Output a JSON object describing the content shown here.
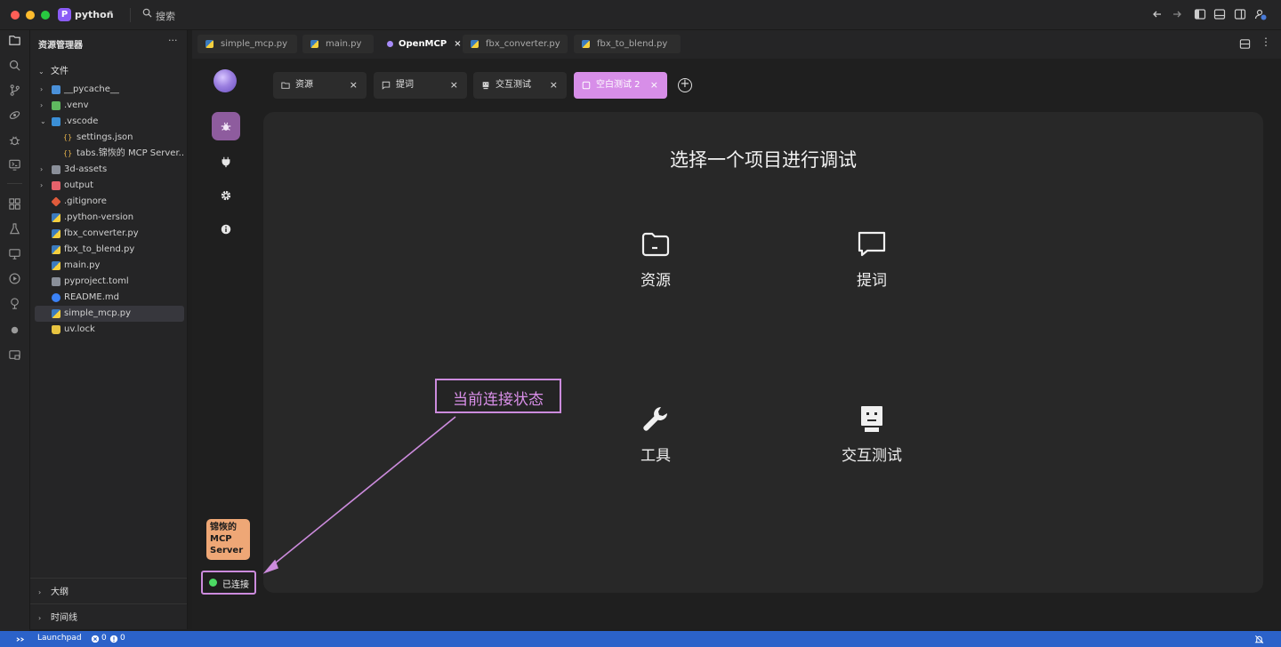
{
  "titlebar": {
    "project_badge": "P",
    "project_name": "python",
    "search_label": "搜索"
  },
  "explorer": {
    "title": "资源管理器",
    "more": "···",
    "files_section": "文件",
    "items": [
      {
        "label": "__pycache__",
        "icon": "folder-icon"
      },
      {
        "label": ".venv",
        "icon": "folder-icon"
      },
      {
        "label": ".vscode",
        "icon": "folder-open-icon"
      },
      {
        "label": "settings.json",
        "icon": "json-icon"
      },
      {
        "label": "tabs.锦恢的 MCP Server...",
        "icon": "json-icon"
      },
      {
        "label": "3d-assets",
        "icon": "folder-icon"
      },
      {
        "label": "output",
        "icon": "folder-icon"
      },
      {
        "label": ".gitignore",
        "icon": "git-icon"
      },
      {
        "label": ".python-version",
        "icon": "python-file-icon"
      },
      {
        "label": "fbx_converter.py",
        "icon": "python-file-icon"
      },
      {
        "label": "fbx_to_blend.py",
        "icon": "python-file-icon"
      },
      {
        "label": "main.py",
        "icon": "python-file-icon"
      },
      {
        "label": "pyproject.toml",
        "icon": "toml-icon"
      },
      {
        "label": "README.md",
        "icon": "info-file-icon"
      },
      {
        "label": "simple_mcp.py",
        "icon": "python-file-icon"
      },
      {
        "label": "uv.lock",
        "icon": "lock-icon"
      }
    ],
    "outline_section": "大纲",
    "timeline_section": "时间线"
  },
  "editor_tabs": [
    {
      "label": "simple_mcp.py"
    },
    {
      "label": "main.py"
    },
    {
      "label": "OpenMCP",
      "close": "×"
    },
    {
      "label": "fbx_converter.py"
    },
    {
      "label": "fbx_to_blend.py"
    }
  ],
  "app": {
    "server_name": "锦恢的 MCP Server",
    "connection_status": "已连接",
    "panel_tabs": [
      {
        "label": "资源",
        "close": "×"
      },
      {
        "label": "提词",
        "close": "×"
      },
      {
        "label": "交互测试",
        "close": "×"
      },
      {
        "label": "空白测试 2",
        "close": "×"
      }
    ],
    "add_tab": "+",
    "panel_title": "选择一个项目进行调试",
    "options": [
      {
        "label": "资源",
        "icon": "folder-icon"
      },
      {
        "label": "提词",
        "icon": "chat-bubble-icon"
      },
      {
        "label": "工具",
        "icon": "wrench-icon"
      },
      {
        "label": "交互测试",
        "icon": "robot-icon"
      }
    ],
    "annotation": "当前连接状态"
  },
  "statusbar": {
    "launchpad": "Launchpad",
    "errors": "0",
    "warnings": "0"
  },
  "colors": {
    "accent": "#d78ee8",
    "active_side": "#8e5c9e",
    "server_card": "#eea776",
    "connected": "#4cd964",
    "statusbar": "#2b62c9"
  }
}
